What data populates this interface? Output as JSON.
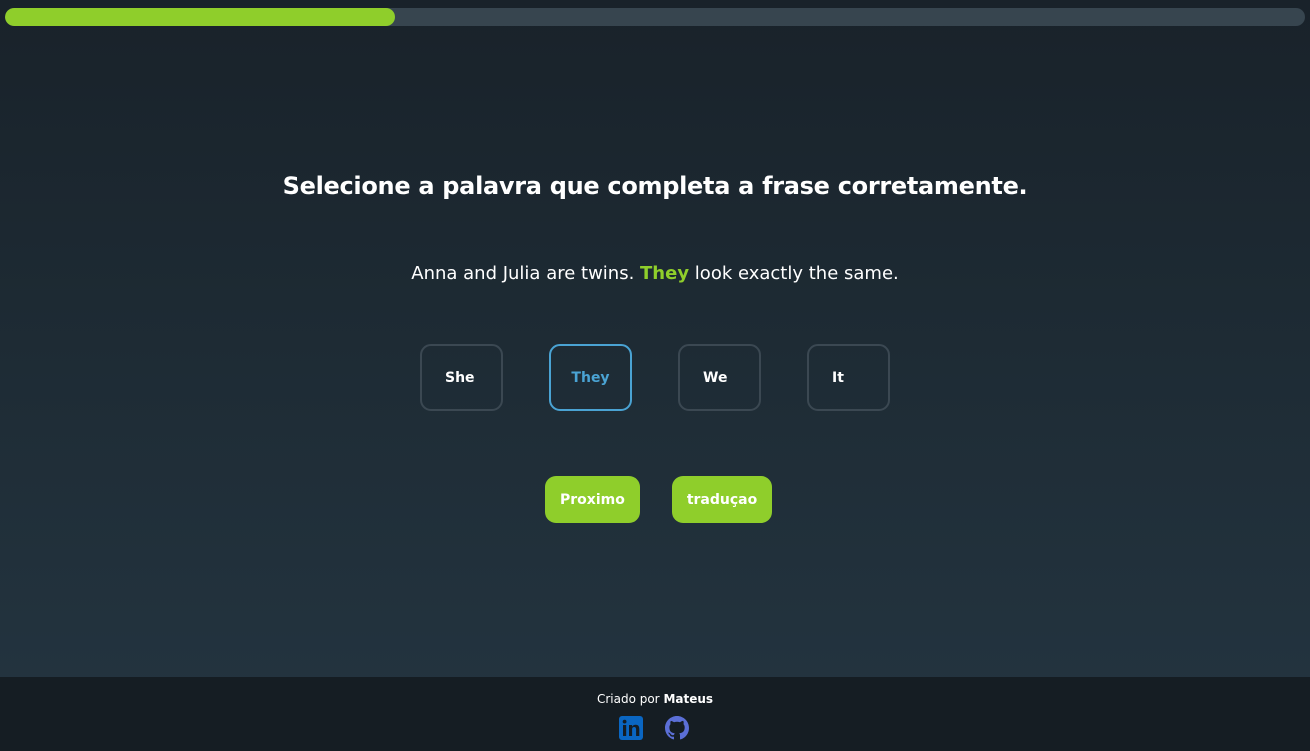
{
  "progress": {
    "value_percent": 30,
    "color": "#8fce2b"
  },
  "question": {
    "instruction": "Selecione a palavra que completa a frase corretamente.",
    "sentence_before": "Anna and Julia are twins. ",
    "sentence_answer": "They",
    "sentence_after": " look exactly the same."
  },
  "options": [
    {
      "label": "She"
    },
    {
      "label": "They",
      "selected": true
    },
    {
      "label": "We"
    },
    {
      "label": "It"
    }
  ],
  "actions": {
    "next_label": "Proximo",
    "translation_label": "traduçao"
  },
  "footer": {
    "credit_prefix": "Criado por ",
    "author": "Mateus",
    "social_icons": [
      "linkedin-icon",
      "github-icon"
    ]
  },
  "colors": {
    "accent": "#8fce2b",
    "selected": "#4aa3d3",
    "linkedin": "#0a66c2",
    "github": "#5b6fd6"
  }
}
